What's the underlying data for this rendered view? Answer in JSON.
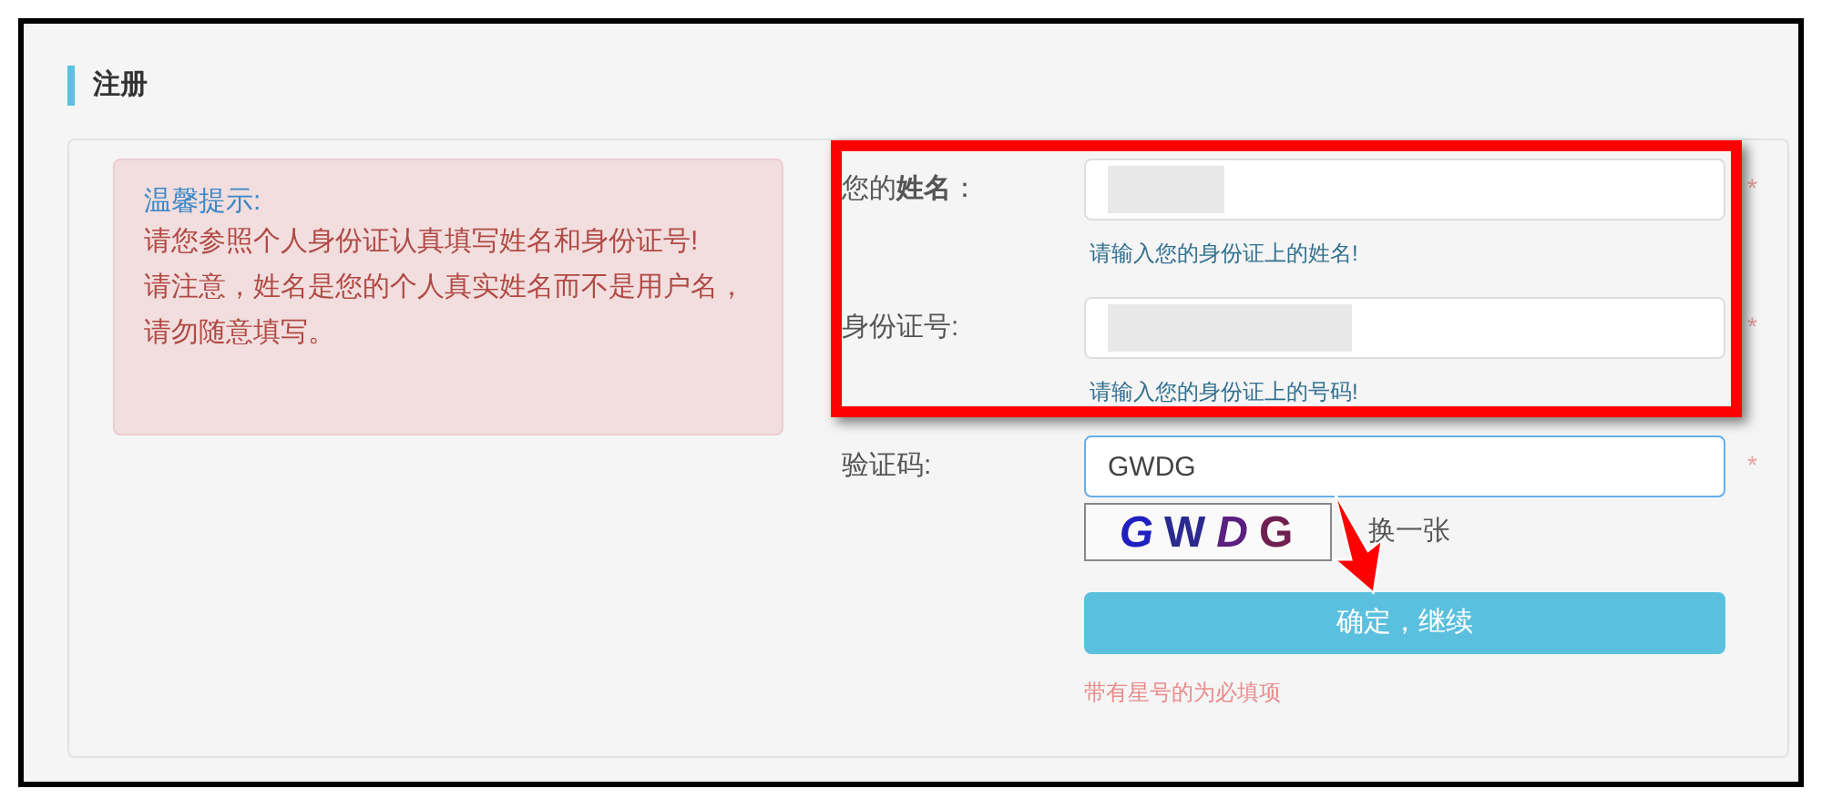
{
  "section_title": "注册",
  "notice": {
    "heading": "温馨提示:",
    "lines": [
      "请您参照个人身份证认真填写姓名和身份证号!",
      "请注意，姓名是您的个人真实姓名而不是用户名，请勿随意填写。"
    ]
  },
  "fields": [
    {
      "label": "您的**姓名**：",
      "kind": "redacted",
      "help": "请输入您的身份证上的姓名!",
      "required": "*",
      "focused": false
    },
    {
      "label": "身份证号:",
      "kind": "redacted",
      "help": "请输入您的身份证上的号码!",
      "required": "*",
      "focused": false
    },
    {
      "label": "验证码:",
      "kind": "text",
      "value": "GWDG",
      "required": "*",
      "focused": true
    }
  ],
  "captcha": {
    "image_text": "GWDG",
    "refresh": "换一张"
  },
  "submit": "确定，继续",
  "required_note": "带有星号的为必填项"
}
